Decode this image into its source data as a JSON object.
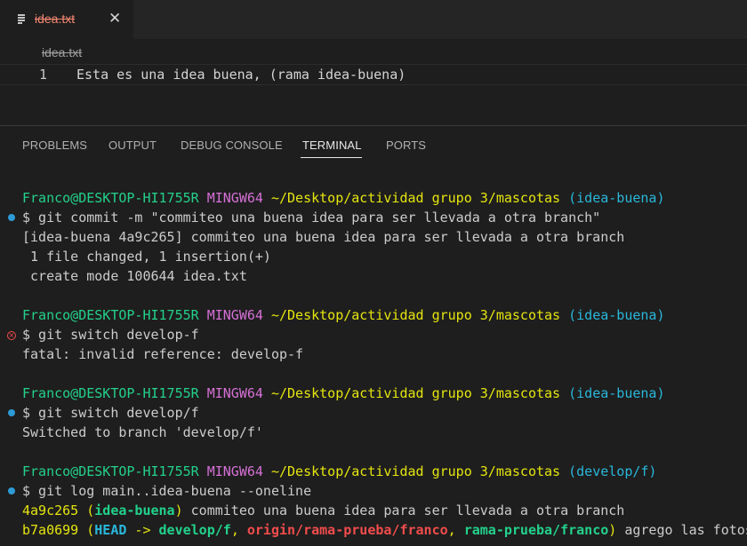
{
  "editor": {
    "tab_label": "idea.txt",
    "tab_close": "✕",
    "breadcrumb": "idea.txt",
    "line_number": "1",
    "line_text": "Esta es una idea buena, (rama idea-buena)"
  },
  "panel": {
    "tabs": [
      "PROBLEMS",
      "OUTPUT",
      "DEBUG CONSOLE",
      "TERMINAL",
      "PORTS"
    ],
    "active_tab": "TERMINAL"
  },
  "terminal": {
    "blocks": [
      {
        "prompt": {
          "user": "Franco@DESKTOP-HI1755R",
          "env": "MINGW64",
          "path": "~/Desktop/actividad grupo 3/mascotas",
          "branch": "(idea-buena)"
        },
        "command": "$ git commit -m \"commiteo una buena idea para ser llevada a otra branch\"",
        "status": "ok",
        "output": [
          "[idea-buena 4a9c265] commiteo una buena idea para ser llevada a otra branch",
          " 1 file changed, 1 insertion(+)",
          " create mode 100644 idea.txt"
        ]
      },
      {
        "prompt": {
          "user": "Franco@DESKTOP-HI1755R",
          "env": "MINGW64",
          "path": "~/Desktop/actividad grupo 3/mascotas",
          "branch": "(idea-buena)"
        },
        "command": "$ git switch develop-f",
        "status": "error",
        "output": [
          "fatal: invalid reference: develop-f"
        ]
      },
      {
        "prompt": {
          "user": "Franco@DESKTOP-HI1755R",
          "env": "MINGW64",
          "path": "~/Desktop/actividad grupo 3/mascotas",
          "branch": "(idea-buena)"
        },
        "command": "$ git switch develop/f",
        "status": "ok",
        "output": [
          "Switched to branch 'develop/f'"
        ]
      },
      {
        "prompt": {
          "user": "Franco@DESKTOP-HI1755R",
          "env": "MINGW64",
          "path": "~/Desktop/actividad grupo 3/mascotas",
          "branch": "(develop/f)"
        },
        "command": "$ git log main..idea-buena --oneline",
        "status": "ok",
        "log": [
          {
            "hash": "4a9c265",
            "open": " (",
            "refs": [
              {
                "text": "idea-buena",
                "kind": "branch"
              }
            ],
            "close": ")",
            "message": " commiteo una buena idea para ser llevada a otra branch"
          },
          {
            "hash": "b7a0699",
            "open": " (",
            "refs": [
              {
                "text": "HEAD -> develop/f",
                "kind": "head"
              },
              {
                "text": "origin/rama-prueba/franco",
                "kind": "remote"
              },
              {
                "text": "rama-prueba/franco",
                "kind": "branch"
              }
            ],
            "close": ")",
            "message": " agrego las fotos"
          }
        ]
      }
    ]
  },
  "colors": {
    "background": "#1e1e1e",
    "tab_modified": "#f48771",
    "prompt_user": "#23d18b",
    "prompt_env": "#d670d6",
    "prompt_path": "#e5e510",
    "prompt_branch": "#29b8db",
    "decoration_ok": "#2d9bd6",
    "decoration_error": "#f14c4c"
  }
}
